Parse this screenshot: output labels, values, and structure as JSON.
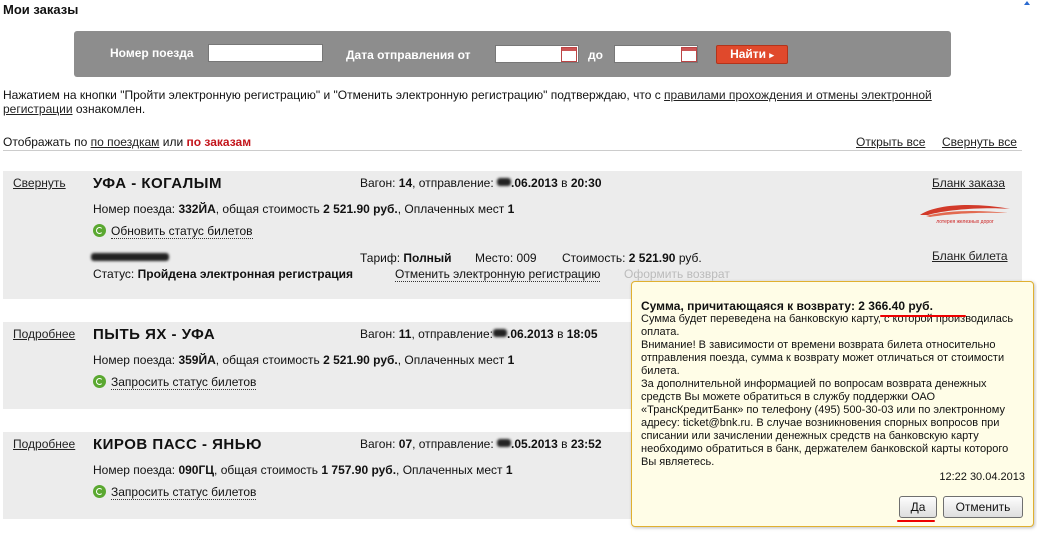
{
  "page": {
    "title": "Мои заказы"
  },
  "search": {
    "train_label": "Номер поезда",
    "train_value": "",
    "date_from_label": "Дата отправления от",
    "date_to_label": "до",
    "find_label": "Найти"
  },
  "info": {
    "text_before": "Нажатием на кнопки \"Пройти электронную регистрацию\" и \"Отменить электронную регистрацию\" подтверждаю, что с ",
    "link": "правилами прохождения и отмены электронной регистрации",
    "text_after": " ознакомлен."
  },
  "view": {
    "prefix": "Отображать по",
    "by_trips": "по поездкам",
    "or": "или",
    "by_orders": "по заказам",
    "expand_all": "Открыть все",
    "collapse_all": "Свернуть все"
  },
  "orders": [
    {
      "toggle": "Свернуть",
      "route": "УФА - КОГАЛЫМ",
      "car_label": "Вагон:",
      "car": "14",
      "departure_label": ", отправление:",
      "departure_date": ".06.2013",
      "departure_time_label": "в",
      "departure_time": "20:30",
      "train_label": "Номер поезда:",
      "train": "332ЙА",
      "total_label": ", общая стоимость",
      "total": "2 521.90 руб.",
      "paid_label": ", Оплаченных мест",
      "paid": "1",
      "status_link": "Обновить статус билетов",
      "order_form": "Бланк заказа",
      "logo_text": "лотерея железных дорог",
      "ticket": {
        "tariff_label": "Тариф:",
        "tariff": "Полный",
        "seat_label": "Место:",
        "seat": "009",
        "cost_label": "Стоимость:",
        "cost": "2 521.90",
        "cost_unit": "руб.",
        "ticket_form": "Бланк билета",
        "status_label": "Статус:",
        "status": "Пройдена электронная регистрация",
        "cancel_reg": "Отменить электронную регистрацию",
        "refund": "Оформить возврат"
      }
    },
    {
      "toggle": "Подробнее",
      "route": "ПЫТЬ ЯХ - УФА",
      "car_label": "Вагон:",
      "car": "11",
      "departure_label": ", отправление:",
      "departure_date": ".06.2013",
      "departure_time_label": "в",
      "departure_time": "18:05",
      "train_label": "Номер поезда:",
      "train": "359ЙА",
      "total_label": ", общая стоимость",
      "total": "2 521.90 руб.",
      "paid_label": ", Оплаченных мест",
      "paid": "1",
      "status_link": "Запросить статус билетов"
    },
    {
      "toggle": "Подробнее",
      "route": "КИРОВ ПАСС - ЯНЬЮ",
      "car_label": "Вагон:",
      "car": "07",
      "departure_label": ", отправление:",
      "departure_date": ".05.2013",
      "departure_time_label": "в",
      "departure_time": "23:52",
      "train_label": "Номер поезда:",
      "train": "090ГЦ",
      "total_label": ", общая стоимость",
      "total": "1 757.90 руб.",
      "paid_label": ", Оплаченных мест",
      "paid": "1",
      "status_link": "Запросить статус билетов"
    }
  ],
  "popup": {
    "amount_label": "Сумма, причитающаяся к возврату:",
    "amount": "2 366.40 руб",
    "amount_dot": ".",
    "line1": "Сумма будет переведена на банковскую карту, с которой производилась оплата.",
    "line2": "Внимание! В зависимости от времени возврата билета относительно отправления поезда, сумма к возврату может отличаться от стоимости билета.",
    "line3": "За дополнительной информацией по вопросам возврата денежных средств Вы можете обратиться в службу поддержки ОАО «ТрансКредитБанк» по телефону (495) 500-30-03 или по электронному адресу: ticket@bnk.ru. В случае возникновения спорных вопросов при списании или зачислении денежных средств на банковскую карту необходимо обратиться в банк, держателем банковской карты которого Вы являетесь.",
    "timestamp": "12:22 30.04.2013",
    "yes": "Да",
    "cancel": "Отменить"
  },
  "colors": {
    "accent_red": "#c3141b",
    "button_red": "#e0492c",
    "panel_gray": "#8d8d8d",
    "order_bg": "#ececec",
    "popup_bg": "#fffde7"
  }
}
